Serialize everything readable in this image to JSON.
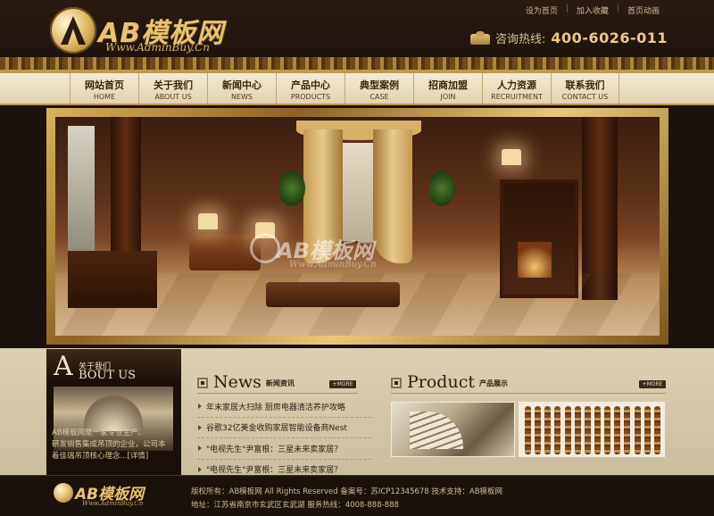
{
  "header": {
    "logo_text": "AB模板网",
    "logo_sub": "Www.AdminBuy.Cn",
    "top_links": [
      "设为首页",
      "加入收藏",
      "首页动画"
    ],
    "hotline_label": "咨询热线:",
    "hotline_number": "400-6026-011"
  },
  "nav": [
    {
      "cn": "网站首页",
      "en": "HOME"
    },
    {
      "cn": "关于我们",
      "en": "ABOUT US"
    },
    {
      "cn": "新闻中心",
      "en": "NEWS"
    },
    {
      "cn": "产品中心",
      "en": "PRODUCTS"
    },
    {
      "cn": "典型案例",
      "en": "CASE"
    },
    {
      "cn": "招商加盟",
      "en": "JOIN"
    },
    {
      "cn": "人力资源",
      "en": "RECRUITMENT"
    },
    {
      "cn": "联系我们",
      "en": "CONTACT US"
    }
  ],
  "banner": {
    "watermark": "AB模板网",
    "watermark_sub": "Www.AdminBuy.Cn"
  },
  "about": {
    "title_cn": "关于我们",
    "title_letter": "A",
    "title_en": "BOUT US",
    "text_lines": [
      "AB模板网是一家专业生产、",
      "研发销售集成吊顶的企业，公司本",
      "着佳瑞吊顶核心理念...[详情]"
    ]
  },
  "news": {
    "title_en": "News",
    "title_cn": "新闻资讯",
    "more": "+MORE",
    "items": [
      "年末家居大扫除 厨房电器清洁养护攻略",
      "谷歌32亿美金收购家居智能设备商Nest",
      "\"电视先生\"尹富根：三星未来卖家居？",
      "\"电视先生\"尹富根：三星未来卖家居？"
    ]
  },
  "product": {
    "title_en": "Product",
    "title_cn": "产品展示",
    "more": "+MORE"
  },
  "footer": {
    "logo_text": "AB模板网",
    "logo_sub": "Www.AdminBuy.Cn",
    "line1": "版权所有：AB模板网 All Rights Reserved   备案号：苏ICP12345678   技术支持：AB模板网",
    "line2": "地址：江苏省南京市玄武区玄武湖   服务热线：4008-888-888"
  }
}
